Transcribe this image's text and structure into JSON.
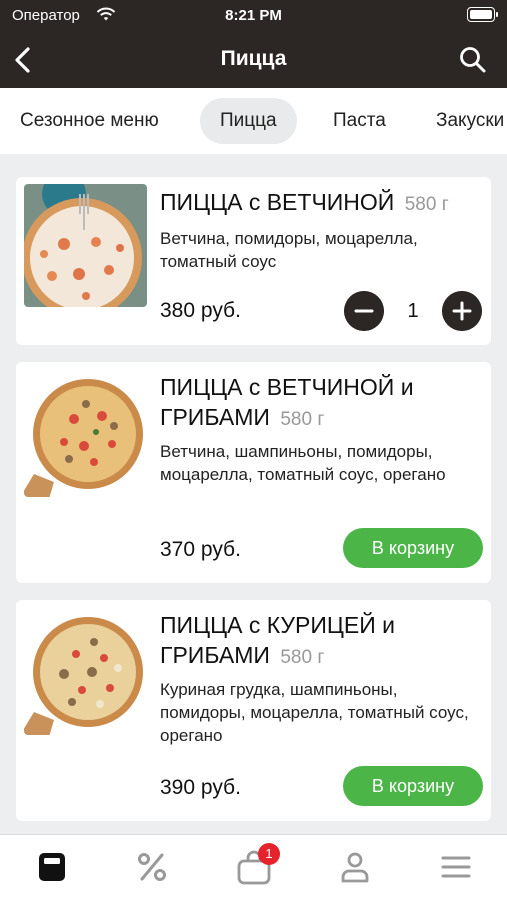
{
  "status_bar": {
    "carrier": "Оператор",
    "time": "8:21 PM"
  },
  "header": {
    "title": "Пицца"
  },
  "categories": [
    {
      "label": "Сезонное меню",
      "active": false
    },
    {
      "label": "Пицца",
      "active": true
    },
    {
      "label": "Паста",
      "active": false
    },
    {
      "label": "Закуски",
      "active": false
    }
  ],
  "products": [
    {
      "name": "ПИЦЦА с ВЕТЧИНОЙ",
      "weight": "580 г",
      "description": "Ветчина, помидоры, моцарелла, томатный соус",
      "price": "380 руб.",
      "quantity": "1",
      "in_cart": true
    },
    {
      "name_line1": "ПИЦЦА с ВЕТЧИНОЙ и",
      "name_line2": "ГРИБАМИ",
      "weight": "580 г",
      "description": "Ветчина, шампиньоны, помидоры, моцарелла, томатный соус, орегано",
      "price": "370 руб.",
      "button": "В корзину",
      "in_cart": false
    },
    {
      "name_line1": "ПИЦЦА с КУРИЦЕЙ и",
      "name_line2": "ГРИБАМИ",
      "weight": "580 г",
      "description": "Куриная грудка, шампиньоны, помидоры, моцарелла, томатный соус, орегано",
      "price": "390 руб.",
      "button": "В корзину",
      "in_cart": false
    }
  ],
  "tab_bar": {
    "items": [
      "menu-icon",
      "discount-icon",
      "cart-icon",
      "profile-icon",
      "hamburger-icon"
    ],
    "cart_badge": "1"
  },
  "colors": {
    "header_bg": "#2c2624",
    "accent_green": "#4bb548",
    "badge_red": "#e5232c"
  }
}
